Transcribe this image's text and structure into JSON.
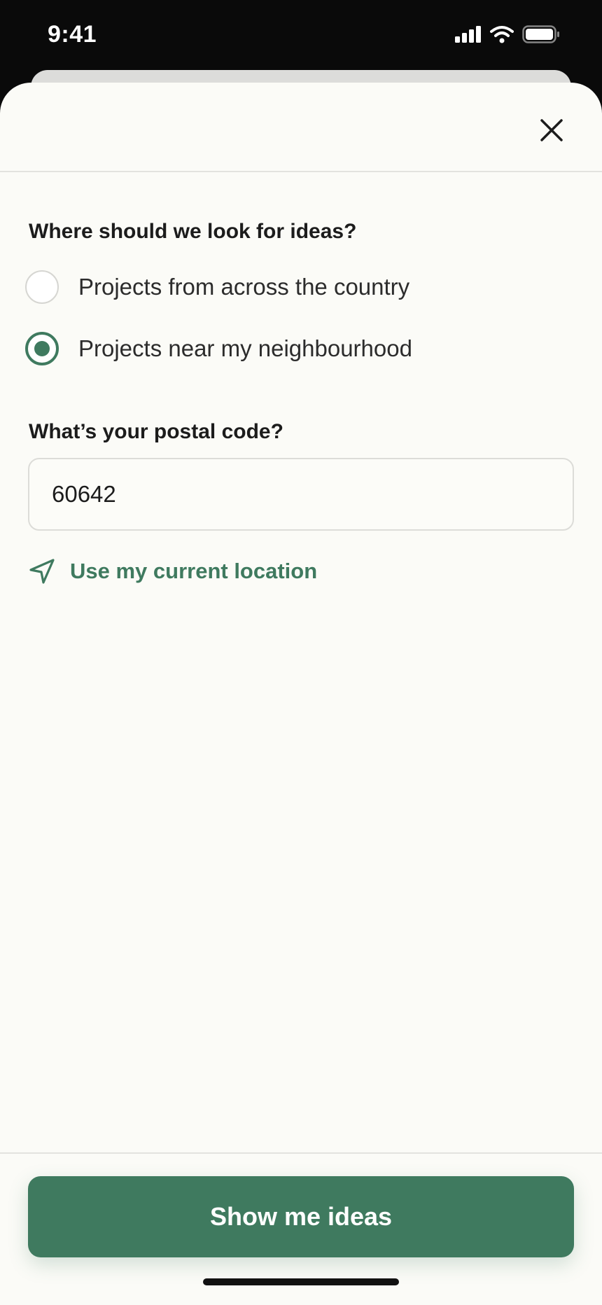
{
  "status_bar": {
    "time": "9:41",
    "icons": [
      "signal-icon",
      "wifi-icon",
      "battery-icon"
    ]
  },
  "sheet": {
    "close_icon": "close-icon",
    "location_question": "Where should we look for ideas?",
    "options": [
      {
        "label": "Projects from across the country",
        "selected": false
      },
      {
        "label": "Projects near my neighbourhood",
        "selected": true
      }
    ],
    "postal_question": "What’s your postal code?",
    "postal_value": "60642",
    "use_location_label": "Use my current location",
    "cta_label": "Show me ideas"
  },
  "colors": {
    "accent": "#3f7a5f",
    "sheet_bg": "#fbfbf7",
    "status_bg": "#0a0a0a"
  }
}
